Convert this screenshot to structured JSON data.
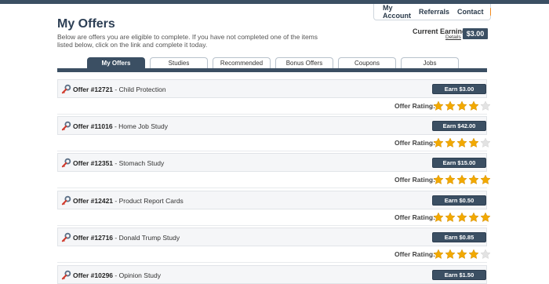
{
  "nav": {
    "links": [
      "My Account",
      "Referrals",
      "Contact"
    ],
    "rss_icon": "rss-icon"
  },
  "page": {
    "title": "My Offers",
    "intro": "Below are offers you are eligible to complete. If you have not completed one of the items listed below, click on the link and complete it today."
  },
  "earnings": {
    "label": "Current Earnings:",
    "details": "Details",
    "amount": "$3.00"
  },
  "tabs": [
    {
      "label": "My Offers",
      "active": true
    },
    {
      "label": "Studies",
      "active": false
    },
    {
      "label": "Recommended",
      "active": false
    },
    {
      "label": "Bonus Offers",
      "active": false
    },
    {
      "label": "Coupons",
      "active": false
    },
    {
      "label": "Jobs",
      "active": false
    }
  ],
  "rating_label": "Offer Rating:",
  "colors": {
    "primary": "#3b4f63",
    "star_on": "#f2a900",
    "star_off": "#e3e3e3"
  },
  "offers": [
    {
      "id": "Offer #12721",
      "name": "Child Protection",
      "earn": "Earn $3.00",
      "rating": 4
    },
    {
      "id": "Offer #11016",
      "name": "Home Job Study",
      "earn": "Earn $42.00",
      "rating": 4
    },
    {
      "id": "Offer #12351",
      "name": "Stomach Study",
      "earn": "Earn $15.00",
      "rating": 5
    },
    {
      "id": "Offer #12421",
      "name": "Product Report Cards",
      "earn": "Earn $0.50",
      "rating": 5
    },
    {
      "id": "Offer #12716",
      "name": "Donald Trump Study",
      "earn": "Earn $0.85",
      "rating": 4
    },
    {
      "id": "Offer #10296",
      "name": "Opinion Study",
      "earn": "Earn $1.50",
      "rating": null
    }
  ]
}
